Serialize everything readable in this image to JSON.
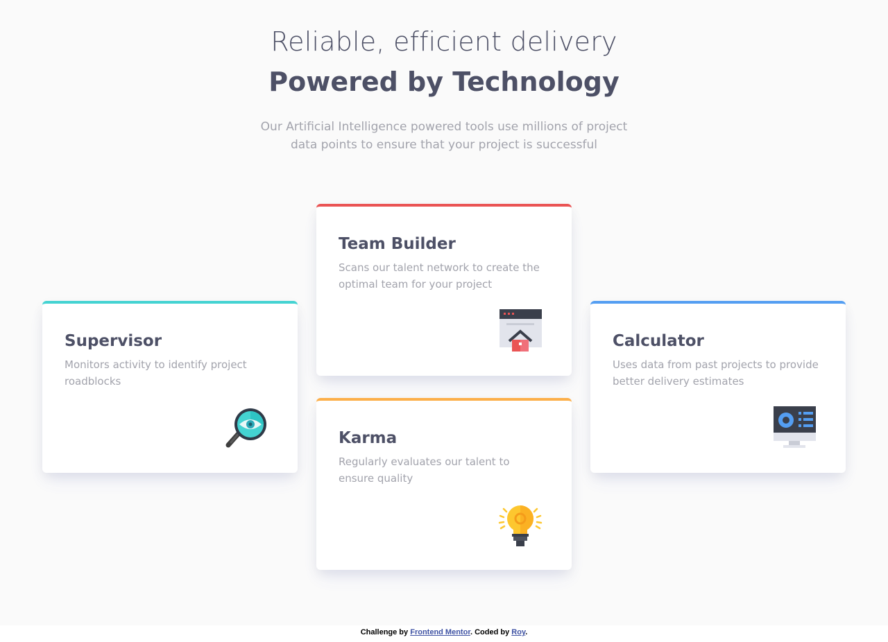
{
  "header": {
    "line1": "Reliable, efficient delivery",
    "line2": "Powered by Technology",
    "intro": "Our Artificial Intelligence powered tools use millions of project data points to ensure that your project is successful"
  },
  "cards": {
    "supervisor": {
      "title": "Supervisor",
      "text": "Monitors activity to identify project roadblocks",
      "icon": "magnifier-eye-icon",
      "accent": "#44d3d2"
    },
    "team_builder": {
      "title": "Team Builder",
      "text": "Scans our talent network to create the optimal team for your project",
      "icon": "browser-house-icon",
      "accent": "#ea5454"
    },
    "karma": {
      "title": "Karma",
      "text": "Regularly evaluates our talent to ensure quality",
      "icon": "lightbulb-icon",
      "accent": "#fcaf4a"
    },
    "calculator": {
      "title": "Calculator",
      "text": "Uses data from past projects to provide better delivery estimates",
      "icon": "monitor-chart-icon",
      "accent": "#549ef2"
    }
  },
  "footer": {
    "prefix": "Challenge by ",
    "link1": "Frontend Mentor",
    "middle": ". Coded by ",
    "link2": "Roy",
    "suffix": "."
  }
}
